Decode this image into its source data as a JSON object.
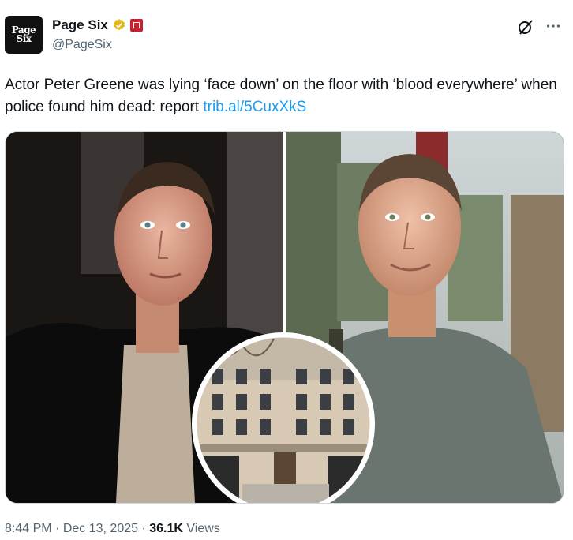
{
  "account": {
    "display_name": "Page Six",
    "handle": "@PageSix",
    "avatar_text_line1": "Page",
    "avatar_text_line2": "Six",
    "verified_icon": "verified-badge-icon",
    "affiliation_icon": "affiliate-badge-icon"
  },
  "tweet": {
    "text": "Actor Peter Greene was lying ‘face down’ on the floor with ‘blood everywhere’ when police found him dead: report",
    "link": "trib.al/5CuxXkS"
  },
  "media": {
    "description_icon": "photo-collage"
  },
  "meta": {
    "time": "8:44 PM",
    "sep1": "·",
    "date": "Dec 13, 2025",
    "sep2": "·",
    "views_count": "36.1K",
    "views_label": "Views"
  },
  "colors": {
    "link": "#1d9bf0",
    "muted": "#536471",
    "verified": "#e2b719"
  }
}
